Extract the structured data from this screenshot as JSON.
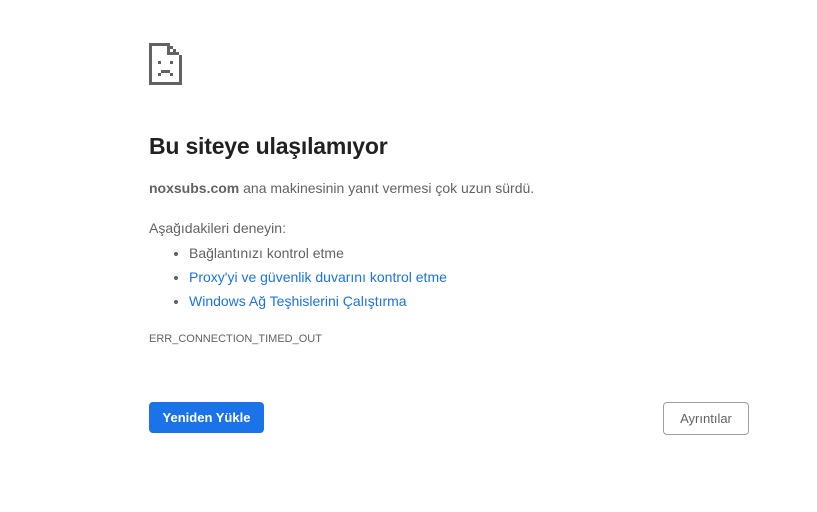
{
  "error": {
    "icon": "sad-page-icon",
    "title": "Bu siteye ulaşılamıyor",
    "host": "noxsubs.com",
    "description_rest": " ana makinesinin yanıt vermesi çok uzun sürdü.",
    "try_label": "Aşağıdakileri deneyin:",
    "suggestions": [
      {
        "label": "Bağlantınızı kontrol etme",
        "link": false
      },
      {
        "label": "Proxy'yi ve güvenlik duvarını kontrol etme",
        "link": true
      },
      {
        "label": "Windows Ağ Teşhislerini Çalıştırma",
        "link": true
      }
    ],
    "code": "ERR_CONNECTION_TIMED_OUT"
  },
  "buttons": {
    "reload_label": "Yeniden Yükle",
    "details_label": "Ayrıntılar"
  },
  "colors": {
    "accent": "#1a73e8",
    "text": "#202124",
    "secondary_text": "#5f6368"
  }
}
